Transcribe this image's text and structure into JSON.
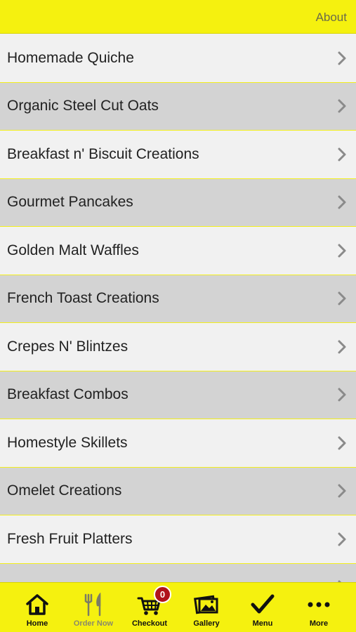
{
  "header": {
    "about_label": "About"
  },
  "menu": {
    "items": [
      {
        "label": "Homemade Quiche"
      },
      {
        "label": "Organic Steel Cut Oats"
      },
      {
        "label": "Breakfast n' Biscuit Creations"
      },
      {
        "label": "Gourmet Pancakes"
      },
      {
        "label": "Golden Malt Waffles"
      },
      {
        "label": "French Toast Creations"
      },
      {
        "label": "Crepes N' Blintzes"
      },
      {
        "label": "Breakfast Combos"
      },
      {
        "label": "Homestyle Skillets"
      },
      {
        "label": "Omelet Creations"
      },
      {
        "label": "Fresh Fruit Platters"
      },
      {
        "label": ""
      }
    ]
  },
  "tabbar": {
    "home": {
      "label": "Home",
      "icon": "home-icon"
    },
    "order_now": {
      "label": "Order Now",
      "icon": "fork-knife-icon"
    },
    "checkout": {
      "label": "Checkout",
      "icon": "cart-icon",
      "badge": "0"
    },
    "gallery": {
      "label": "Gallery",
      "icon": "gallery-icon"
    },
    "menu": {
      "label": "Menu",
      "icon": "checkmark-icon"
    },
    "more": {
      "label": "More",
      "icon": "more-dots-icon"
    }
  },
  "colors": {
    "accent": "#f5f10f",
    "row_light": "#f1f1f1",
    "row_dark": "#d3d3d3",
    "badge": "#b0121b"
  }
}
